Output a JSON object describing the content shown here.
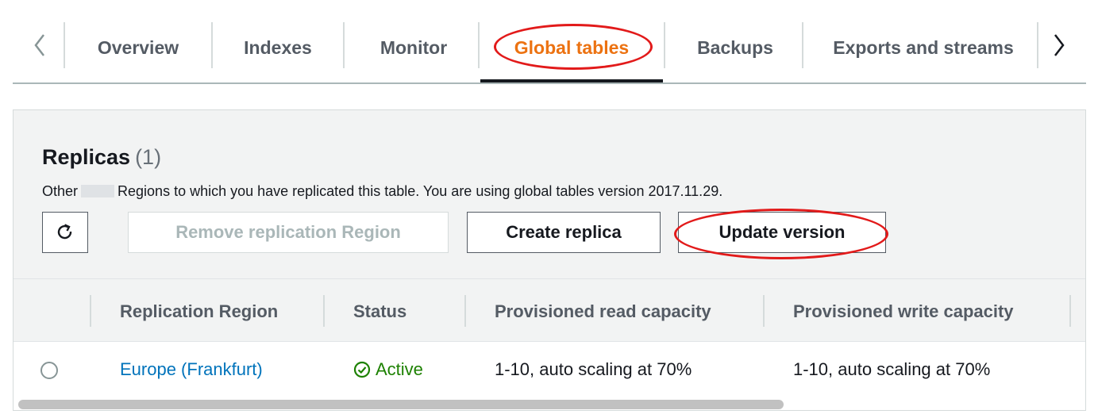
{
  "tabs": {
    "items": [
      {
        "label": "Overview",
        "active": false
      },
      {
        "label": "Indexes",
        "active": false
      },
      {
        "label": "Monitor",
        "active": false
      },
      {
        "label": "Global tables",
        "active": true
      },
      {
        "label": "Backups",
        "active": false
      },
      {
        "label": "Exports and streams",
        "active": false
      }
    ],
    "prev_icon": "chevron-left-icon",
    "next_icon": "chevron-right-icon"
  },
  "replicas": {
    "title": "Replicas",
    "count": "(1)",
    "description_prefix": "Other",
    "description_suffix": "Regions to which you have replicated this table. You are using global tables version 2017.11.29.",
    "refresh_icon": "refresh-icon",
    "buttons": {
      "remove": "Remove replication Region",
      "create": "Create replica",
      "update": "Update version"
    }
  },
  "table": {
    "columns": [
      "Replication Region",
      "Status",
      "Provisioned read capacity",
      "Provisioned write capacity"
    ],
    "rows": [
      {
        "region": "Europe (Frankfurt)",
        "status": "Active",
        "read_capacity": "1-10, auto scaling at 70%",
        "write_capacity": "1-10, auto scaling at 70%"
      }
    ],
    "status_icon": "check-circle-icon"
  },
  "colors": {
    "accent": "#ec7211",
    "link": "#0073bb",
    "success": "#1d8102",
    "annotation": "#e21a1a"
  }
}
